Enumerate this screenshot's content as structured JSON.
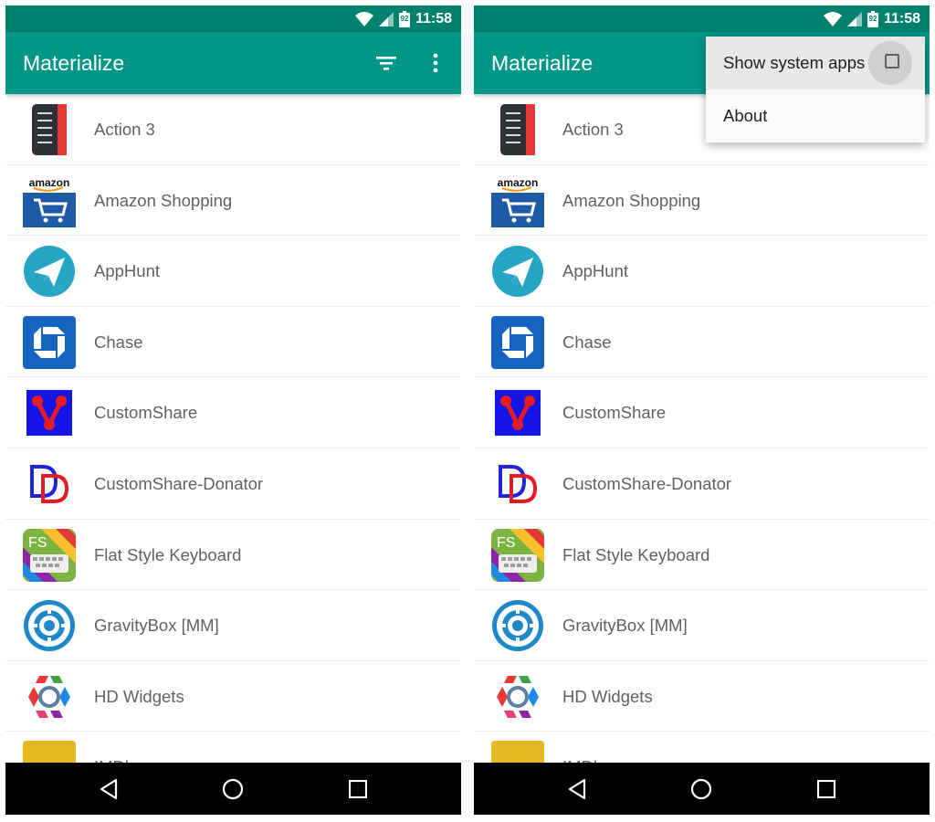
{
  "status_bar": {
    "time": "11:58",
    "battery_level": "92"
  },
  "app_bar": {
    "title": "Materialize",
    "filter_icon": "filter-icon",
    "overflow_icon": "more-vert-icon"
  },
  "apps": [
    {
      "label": "Action 3",
      "icon": "action3-icon"
    },
    {
      "label": "Amazon Shopping",
      "icon": "amazon-icon"
    },
    {
      "label": "AppHunt",
      "icon": "apphunt-icon"
    },
    {
      "label": "Chase",
      "icon": "chase-icon"
    },
    {
      "label": "CustomShare",
      "icon": "customshare-icon"
    },
    {
      "label": "CustomShare-Donator",
      "icon": "donator-icon"
    },
    {
      "label": "Flat Style Keyboard",
      "icon": "keyboard-icon"
    },
    {
      "label": "GravityBox [MM]",
      "icon": "gravitybox-icon"
    },
    {
      "label": "HD Widgets",
      "icon": "hdwidgets-icon"
    },
    {
      "label": "IMDb",
      "icon": "imdb-icon"
    }
  ],
  "icon_text": {
    "amazon": "amazon",
    "flat_keyboard": "FS"
  },
  "overflow_menu": {
    "show_system_apps": "Show system apps",
    "show_system_apps_checked": false,
    "about": "About"
  },
  "colors": {
    "primary": "#009688",
    "primary_dark": "#00806f",
    "nav_bar": "#000000"
  }
}
